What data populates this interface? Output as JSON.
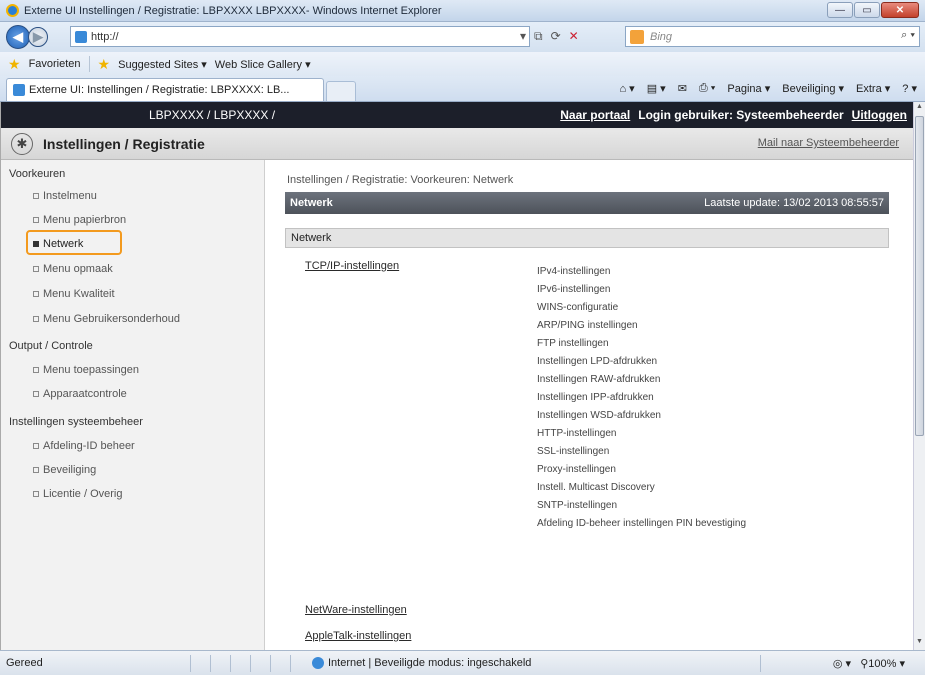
{
  "browser": {
    "window_title": "Externe UI Instellingen / Registratie: LBPXXXX LBPXXXX- Windows Internet Explorer",
    "address": "http://",
    "search_placeholder": "Bing",
    "favorites": "Favorieten",
    "suggested_sites": "Suggested Sites ▾",
    "web_slice_gallery": "Web Slice Gallery ▾",
    "tab_title": "Externe UI: Instellingen / Registratie: LBPXXXX: LB...",
    "cmd": {
      "pagina": "Pagina ▾",
      "beveiliging": "Beveiliging ▾",
      "extra": "Extra ▾"
    },
    "window_buttons": {
      "minimize": "—",
      "maximize": "▭",
      "close": "✕"
    }
  },
  "header": {
    "printer": "LBPXXXX / LBPXXXX /",
    "portal": "Naar portaal",
    "login": "Login gebruiker: Systeembeheerder",
    "logout": "Uitloggen"
  },
  "section": {
    "title": "Instellingen / Registratie",
    "mail": "Mail naar Systeembeheerder"
  },
  "sidebar": {
    "categories": [
      "Voorkeuren",
      "Output / Controle",
      "Instellingen systeembeheer"
    ],
    "items": [
      "Instelmenu",
      "Menu papierbron",
      "Netwerk",
      "Menu opmaak",
      "Menu Kwaliteit",
      "Menu Gebruikersonderhoud",
      "Menu toepassingen",
      "Apparaatcontrole",
      "Afdeling-ID beheer",
      "Beveiliging",
      "Licentie / Overig"
    ]
  },
  "content": {
    "breadcrumb": "Instellingen / Registratie: Voorkeuren: Netwerk",
    "bar_title": "Netwerk",
    "last_update": "Laatste update: 13/02 2013 08:55:57",
    "sub_title": "Netwerk",
    "tcpip": "TCP/IP-instellingen",
    "tcpip_items": [
      "IPv4-instellingen",
      "IPv6-instellingen",
      "WINS-configuratie",
      "ARP/PING instellingen",
      "FTP instellingen",
      "Instellingen LPD-afdrukken",
      "Instellingen RAW-afdrukken",
      "Instellingen IPP-afdrukken",
      "Instellingen WSD-afdrukken",
      "HTTP-instellingen",
      "SSL-instellingen",
      "Proxy-instellingen",
      "Instell. Multicast Discovery",
      "SNTP-instellingen",
      "Afdeling ID-beheer instellingen PIN bevestiging"
    ],
    "netware": "NetWare-instellingen",
    "appletalk": "AppleTalk-instellingen"
  },
  "status": {
    "text": "Gereed",
    "zone": "Internet | Beveiligde modus: ingeschakeld",
    "zoom": "100%"
  }
}
